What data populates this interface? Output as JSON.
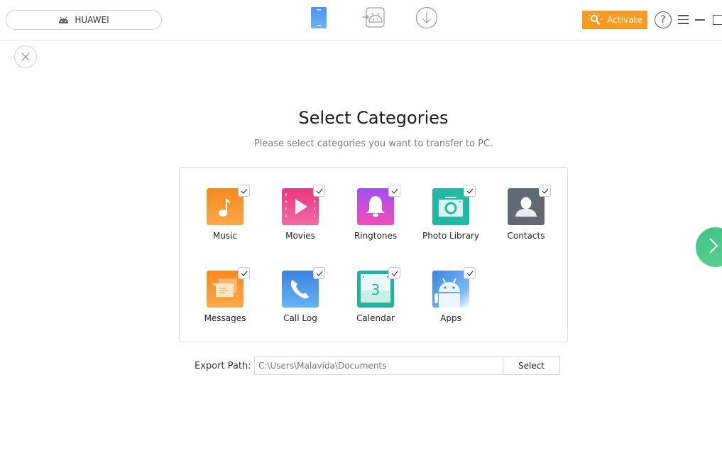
{
  "topbar": {
    "device_name": "HUAWEI",
    "device_icon": "android-icon",
    "nav_icons": [
      {
        "name": "phone-manager-icon",
        "active": true
      },
      {
        "name": "android-transfer-icon",
        "active": false
      },
      {
        "name": "download-icon",
        "active": false
      }
    ],
    "activate_label": "Activate",
    "help_label": "?",
    "accent_color": "#f59a23"
  },
  "main": {
    "title": "Select Categories",
    "subtitle": "Please select categories you want to transfer to PC.",
    "categories": [
      {
        "label": "Music",
        "icon": "music-icon",
        "checked": true
      },
      {
        "label": "Movies",
        "icon": "movies-icon",
        "checked": true
      },
      {
        "label": "Ringtones",
        "icon": "ringtones-icon",
        "checked": true
      },
      {
        "label": "Photo Library",
        "icon": "photo-library-icon",
        "checked": true
      },
      {
        "label": "Contacts",
        "icon": "contacts-icon",
        "checked": true
      },
      {
        "label": "Messages",
        "icon": "messages-icon",
        "checked": true
      },
      {
        "label": "Call Log",
        "icon": "call-log-icon",
        "checked": true
      },
      {
        "label": "Calendar",
        "icon": "calendar-icon",
        "checked": true,
        "day": "3"
      },
      {
        "label": "Apps",
        "icon": "apps-icon",
        "checked": true
      }
    ],
    "export": {
      "label": "Export Path:",
      "path": "C:\\Users\\Malavida\\Documents",
      "select_label": "Select"
    },
    "next_color": "#3ec48a"
  }
}
